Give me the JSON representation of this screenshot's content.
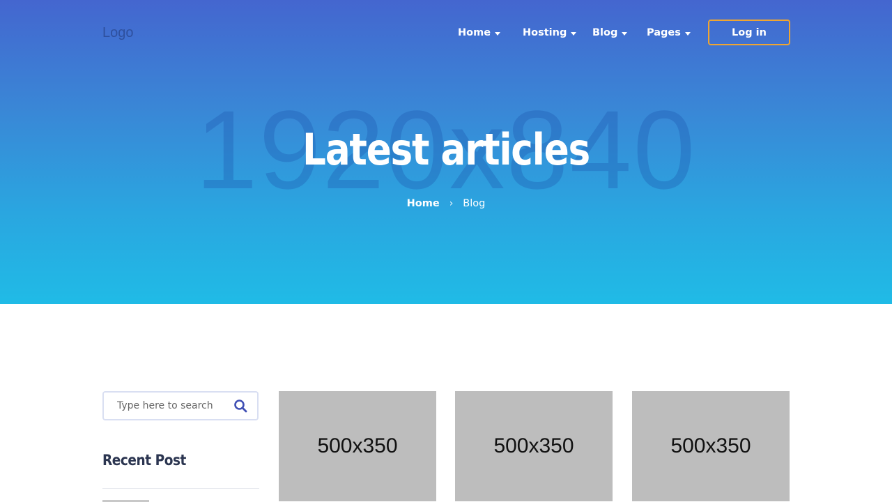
{
  "header": {
    "logo": "Logo",
    "nav": [
      {
        "label": "Home"
      },
      {
        "label": "Hosting"
      },
      {
        "label": "Blog"
      },
      {
        "label": "Pages"
      }
    ],
    "login_label": "Log in",
    "accent_color": "#f0a531"
  },
  "hero": {
    "background_placeholder": "1920x840",
    "title": "Latest articles",
    "breadcrumb": {
      "home": "Home",
      "separator": "›",
      "current": "Blog"
    }
  },
  "sidebar": {
    "search": {
      "placeholder": "Type here to search",
      "value": ""
    },
    "recent_heading": "Recent Post"
  },
  "articles": [
    {
      "image_placeholder": "500x350"
    },
    {
      "image_placeholder": "500x350"
    },
    {
      "image_placeholder": "500x350"
    }
  ]
}
